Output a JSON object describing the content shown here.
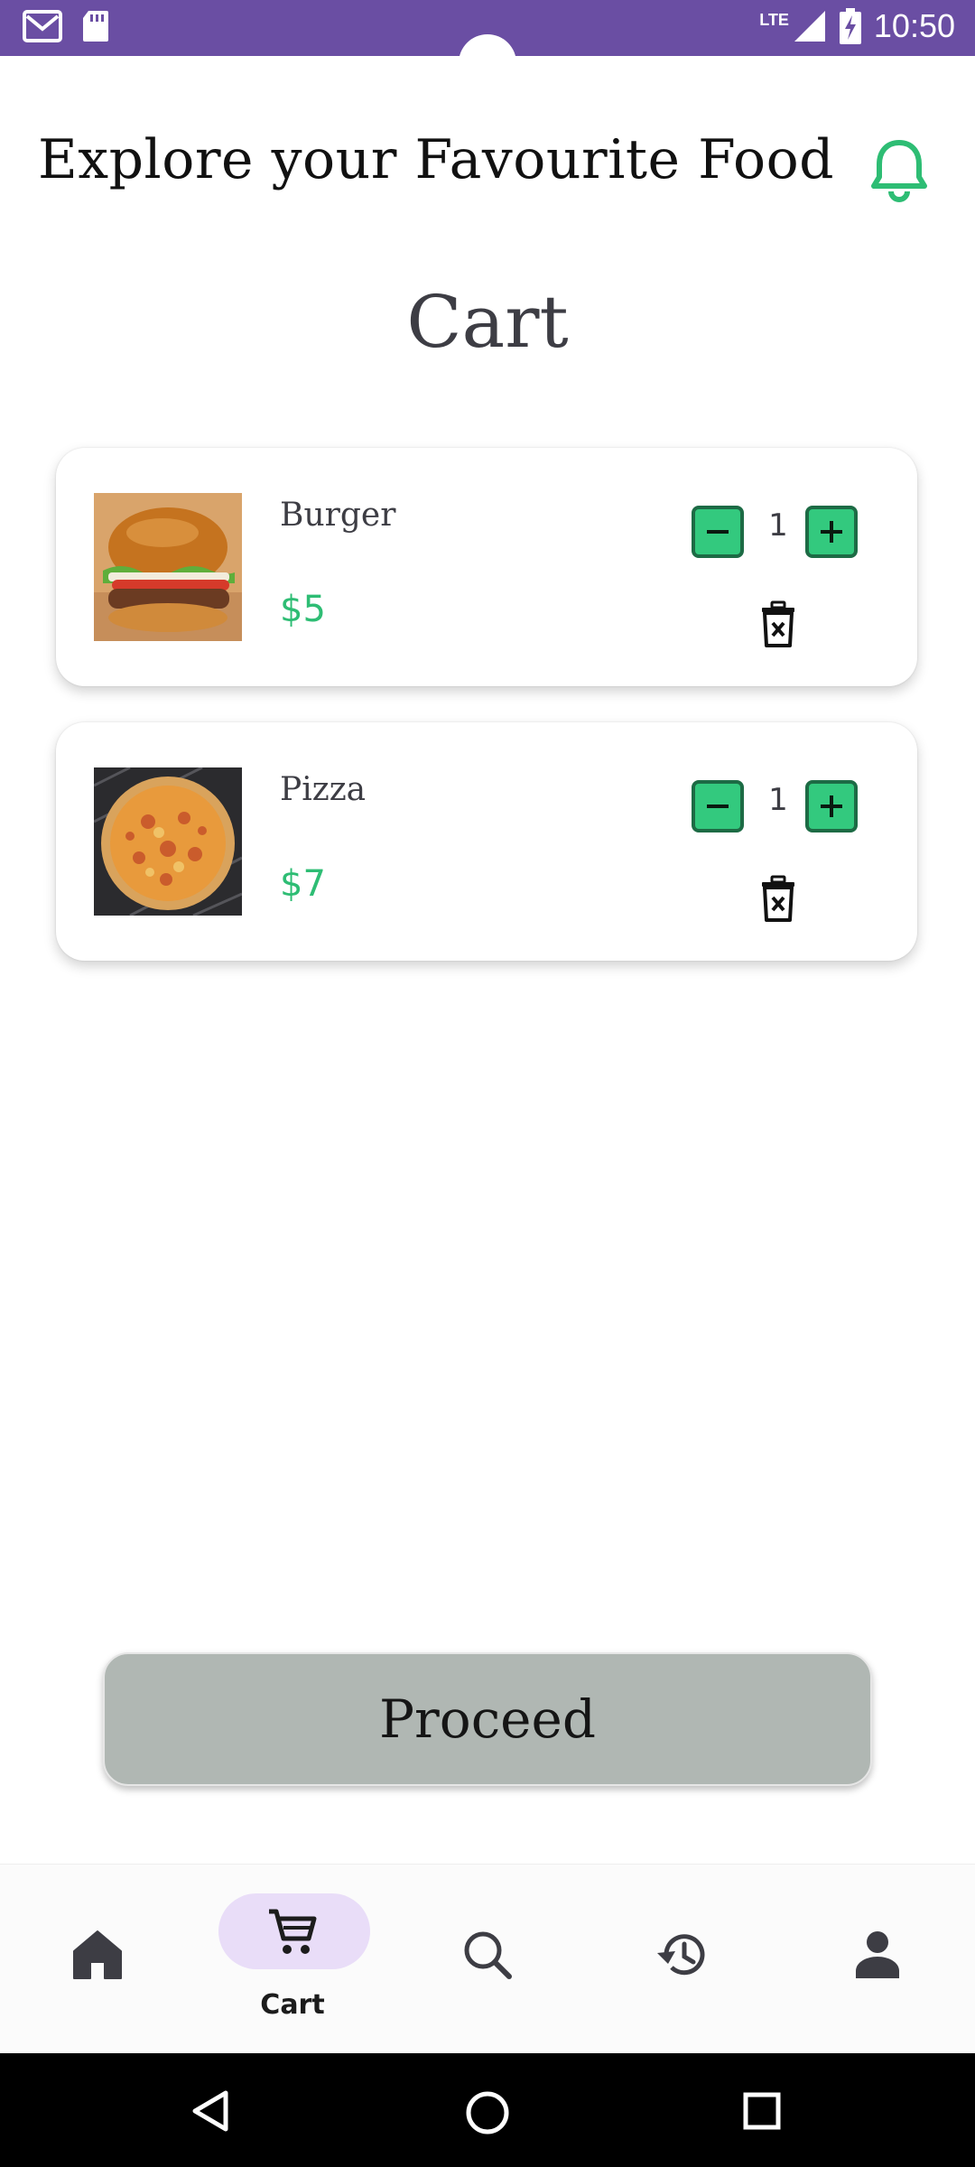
{
  "status_bar": {
    "network": "LTE",
    "time": "10:50",
    "icons": [
      "gmail-icon",
      "sd-card-icon",
      "signal-icon",
      "battery-charging-icon"
    ]
  },
  "header": {
    "title": "Explore your Favourite Food",
    "notification_icon": "bell-icon"
  },
  "page": {
    "title": "Cart"
  },
  "cart": {
    "items": [
      {
        "name": "Burger",
        "price": "$5",
        "quantity": "1",
        "image": "burger-image"
      },
      {
        "name": "Pizza",
        "price": "$7",
        "quantity": "1",
        "image": "pizza-image"
      }
    ]
  },
  "proceed": {
    "label": "Proceed"
  },
  "bottom_nav": {
    "items": [
      {
        "icon": "home-icon",
        "label": ""
      },
      {
        "icon": "cart-icon",
        "label": "Cart",
        "active": true
      },
      {
        "icon": "search-icon",
        "label": ""
      },
      {
        "icon": "history-icon",
        "label": ""
      },
      {
        "icon": "profile-icon",
        "label": ""
      }
    ]
  },
  "system_nav": {
    "icons": [
      "back-icon",
      "home-circle-icon",
      "recents-icon"
    ]
  },
  "colors": {
    "status_bar": "#6a4ea3",
    "accent_green": "#2ebd74",
    "proceed_button": "#b0b7b3",
    "nav_active_pill": "#e9ddf8"
  }
}
